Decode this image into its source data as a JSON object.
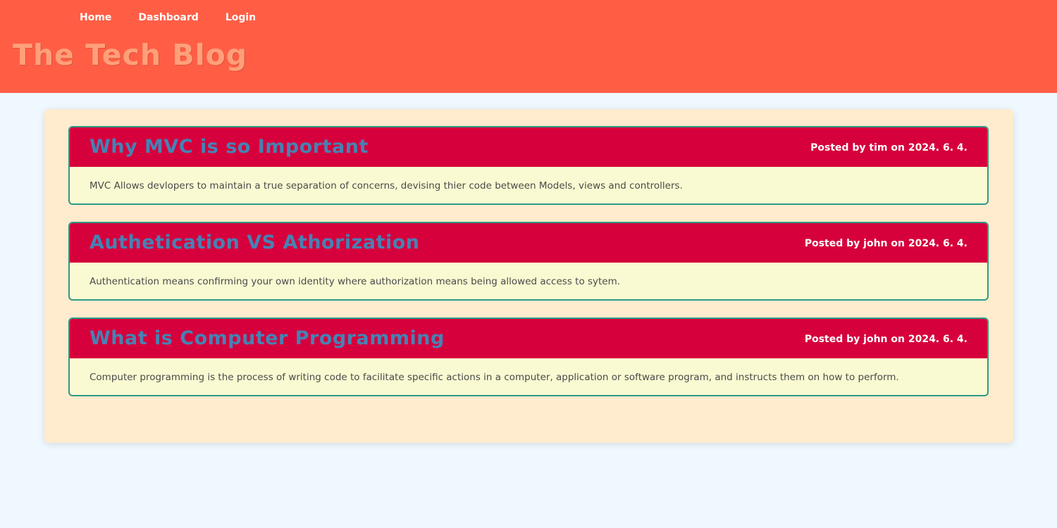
{
  "nav": {
    "home": "Home",
    "dashboard": "Dashboard",
    "login": "Login"
  },
  "site": {
    "title": "The Tech Blog"
  },
  "posts": [
    {
      "title": "Why MVC is so Important",
      "meta": "Posted by tim on 2024. 6. 4.",
      "content": "MVC Allows devlopers to maintain a true separation of concerns, devising thier code between Models, views and controllers."
    },
    {
      "title": "Authetication VS Athorization",
      "meta": "Posted by john on 2024. 6. 4.",
      "content": "Authentication means confirming your own identity where authorization means being allowed access to sytem."
    },
    {
      "title": "What is Computer Programming",
      "meta": "Posted by john on 2024. 6. 4.",
      "content": "Computer programming is the process of writing code to facilitate specific actions in a computer, application or software program, and instructs them on how to perform."
    }
  ],
  "colors": {
    "header_bg": "#ff5e45",
    "title_color": "#ffa07a",
    "post_header_bg": "#d6003c",
    "post_title_color": "#4682b4",
    "post_body_bg": "#fafad2",
    "container_bg": "#ffebcd",
    "page_bg": "#f0f8ff"
  }
}
